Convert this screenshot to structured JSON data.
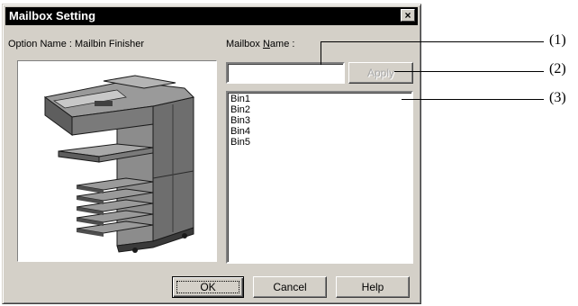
{
  "dialog": {
    "title": "Mailbox Setting",
    "close_glyph": "×",
    "option_name_label": "Option Name : Mailbin Finisher",
    "mailbox_name_label_prefix": "Mailbox ",
    "mailbox_name_label_accel": "N",
    "mailbox_name_label_suffix": "ame :",
    "mailbox_name_value": "",
    "apply_label": "Apply",
    "bins": [
      "Bin1",
      "Bin2",
      "Bin3",
      "Bin4",
      "Bin5"
    ],
    "ok_label": "OK",
    "cancel_label": "Cancel",
    "help_label": "Help",
    "printer_image": "mailbin-finisher-illustration"
  },
  "callouts": [
    "(1)",
    "(2)",
    "(3)"
  ],
  "colors": {
    "dialog_face": "#d4d0c8",
    "titlebar": "#000000",
    "title_text": "#ffffff",
    "disabled_text": "#a8a8a8"
  }
}
